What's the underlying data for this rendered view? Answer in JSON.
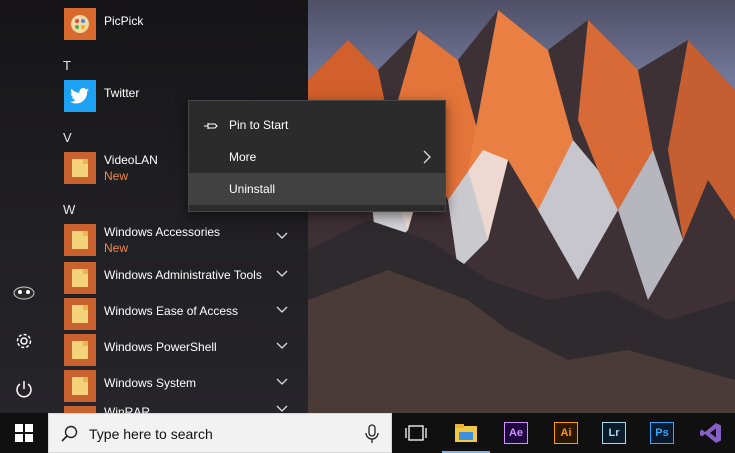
{
  "start_menu": {
    "groups": [
      {
        "letter": "T"
      },
      {
        "letter": "V"
      },
      {
        "letter": "W"
      }
    ],
    "apps": [
      {
        "name": "PicPick",
        "icon": "picpick-icon"
      },
      {
        "name": "Twitter",
        "icon": "twitter-icon"
      },
      {
        "name": "VideoLAN",
        "sub": "New",
        "icon": "folder-icon"
      },
      {
        "name": "Windows Accessories",
        "sub": "New",
        "icon": "folder-icon"
      },
      {
        "name": "Windows Administrative Tools",
        "icon": "folder-icon"
      },
      {
        "name": "Windows Ease of Access",
        "icon": "folder-icon"
      },
      {
        "name": "Windows PowerShell",
        "icon": "folder-icon"
      },
      {
        "name": "Windows System",
        "icon": "folder-icon"
      },
      {
        "name": "WinRAR",
        "icon": "folder-icon"
      }
    ],
    "rail": [
      "user-avatar-icon",
      "settings-icon",
      "power-icon"
    ]
  },
  "context_menu": {
    "items": [
      {
        "label": "Pin to Start",
        "icon": "pin-icon"
      },
      {
        "label": "More",
        "icon": "chevron-right-icon"
      },
      {
        "label": "Uninstall",
        "highlighted": true
      }
    ]
  },
  "taskbar": {
    "search_placeholder": "Type here to search",
    "apps": [
      {
        "name": "task-view-icon"
      },
      {
        "name": "file-explorer-icon",
        "active": true
      },
      {
        "name": "after-effects-icon",
        "label": "Ae",
        "color": "#d291ff"
      },
      {
        "name": "illustrator-icon",
        "label": "Ai",
        "color": "#ff9a00"
      },
      {
        "name": "lightroom-icon",
        "label": "Lr",
        "color": "#add5ec"
      },
      {
        "name": "photoshop-icon",
        "label": "Ps",
        "color": "#31a8ff"
      },
      {
        "name": "visual-studio-icon",
        "color": "#865fc5"
      }
    ]
  },
  "colors": {
    "accent_tile": "#c9622e",
    "new_badge": "#f08a4b",
    "taskbar_bg": "#101010"
  }
}
